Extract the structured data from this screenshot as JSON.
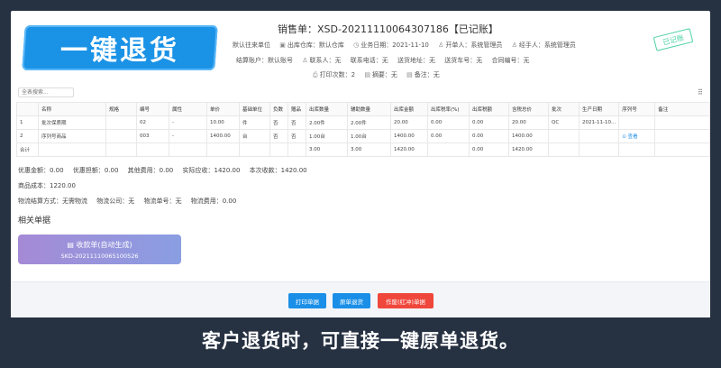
{
  "banner": {
    "text": "一键退货"
  },
  "document": {
    "title": "销售单：XSD-20211110064307186【已记账】",
    "stamp": "已记账",
    "meta_row1": [
      {
        "icon": "home-icon",
        "text": "默认往来单位"
      },
      {
        "icon": "warehouse-icon",
        "text": "出库仓库：默认仓库"
      },
      {
        "icon": "clock-icon",
        "text": "业务日期：2021-11-10"
      },
      {
        "icon": "user-icon",
        "text": "开单人：系统管理员"
      },
      {
        "icon": "user-icon",
        "text": "经手人：系统管理员"
      }
    ],
    "meta_row2": [
      {
        "text": "结算账户：默认账号"
      },
      {
        "icon": "user-icon",
        "text": "联系人：无"
      },
      {
        "text": "联系电话：无"
      },
      {
        "text": "送货地址：无"
      },
      {
        "text": "送货车号：无"
      },
      {
        "text": "合同编号：无"
      }
    ],
    "meta_row3": [
      {
        "icon": "print-icon",
        "text": "打印次数：2"
      },
      {
        "icon": "file-icon",
        "text": "摘要：无"
      },
      {
        "icon": "file-icon",
        "text": "备注：无"
      }
    ]
  },
  "search": {
    "placeholder": "全表搜索..."
  },
  "table": {
    "headers": [
      "",
      "名称",
      "规格",
      "编号",
      "属性",
      "单价",
      "基础单位",
      "负数",
      "赠品",
      "出库数量",
      "辅助数量",
      "出库金额",
      "出库税率(%)",
      "出库税额",
      "含税总价",
      "批次",
      "生产日期",
      "序列号",
      "备注"
    ],
    "rows": [
      [
        "1",
        "批次保质期",
        "",
        "02",
        "-",
        "10.00",
        "件",
        "否",
        "否",
        "2.00件",
        "2.00件",
        "20.00",
        "0.00",
        "0.00",
        "20.00",
        "QC",
        "2021-11-10...",
        "",
        ""
      ],
      [
        "2",
        "序列号商品",
        "",
        "003",
        "-",
        "1400.00",
        "台",
        "否",
        "否",
        "1.00台",
        "1.00台",
        "1400.00",
        "0.00",
        "0.00",
        "1400.00",
        "",
        "",
        "⊙ 查看",
        ""
      ],
      [
        "合计",
        "",
        "",
        "",
        "",
        "",
        "",
        "",
        "",
        "3.00",
        "3.00",
        "1420.00",
        "",
        "0.00",
        "1420.00",
        "",
        "",
        "",
        ""
      ]
    ]
  },
  "summary": {
    "line1": [
      "优惠金额：0.00",
      "优惠担额：0.00",
      "其他费用：0.00",
      "实际应收：1420.00",
      "本次收款：1420.00"
    ],
    "line2": [
      "商品成本：1220.00"
    ],
    "line3": [
      "物流结算方式：无需物流",
      "物流公司：无",
      "物流单号：无",
      "物流费用：0.00"
    ]
  },
  "related": {
    "title": "相关单据",
    "receipt_title": "收款单(自动生成)",
    "receipt_no": "SKD-20211110065100526"
  },
  "buttons": {
    "print": "打印单据",
    "return": "原单退货",
    "void": "作废(红冲)单据"
  },
  "caption": "客户退货时，可直接一键原单退货。",
  "colors": {
    "accent": "#1b8fe8",
    "danger": "#f0473c",
    "stamp": "#4cd1a3",
    "background": "#263142"
  }
}
